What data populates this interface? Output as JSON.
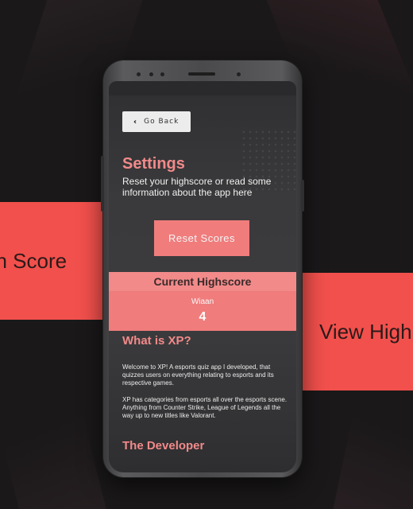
{
  "background": {
    "left_card_text": "gh Score",
    "right_card_text": "View High"
  },
  "screen": {
    "back_button": {
      "icon": "chevron-left-icon",
      "label": "Go Back"
    },
    "settings": {
      "title": "Settings",
      "description": "Reset your highscore or read some information about the app here"
    },
    "reset_button_label": "Reset Scores",
    "highscore": {
      "title": "Current Highscore",
      "name": "Wiaan",
      "score": "4"
    },
    "about": {
      "title": "What is XP?",
      "paragraph1": "Welcome to XP! A esports quiz app I developed, that quizzes users on everything relating to esports and its respective games.",
      "paragraph2": "XP has categories from esports all over the esports scene. Anything from Counter Strike, League of Legends all the way up to new titles like Valorant."
    },
    "developer": {
      "title": "The Developer"
    }
  },
  "colors": {
    "accent": "#f28a8a",
    "button": "#f07c7c",
    "card": "#f2504c",
    "background": "#1a1819"
  }
}
